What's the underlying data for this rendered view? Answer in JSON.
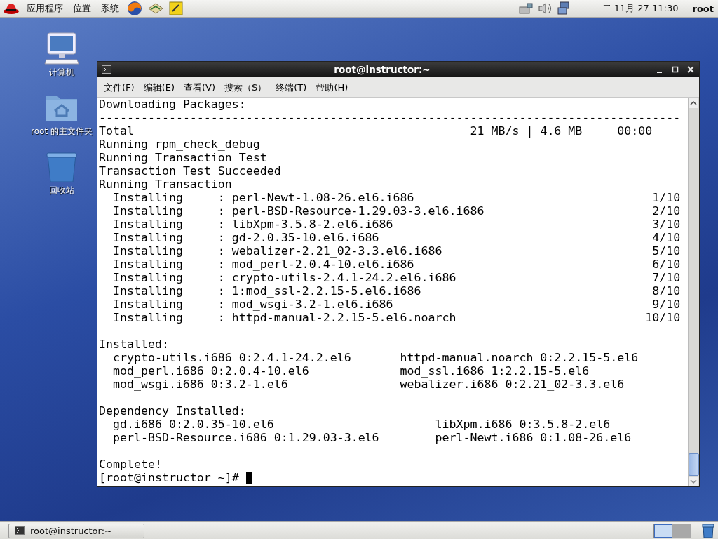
{
  "top_panel": {
    "menus": [
      "应用程序",
      "位置",
      "系统"
    ],
    "clock": "二 11月 27 11:30",
    "user": "root"
  },
  "desktop_icons": [
    {
      "kind": "computer",
      "label": "计算机"
    },
    {
      "kind": "home",
      "label": "root 的主文件夹"
    },
    {
      "kind": "trash",
      "label": "回收站"
    }
  ],
  "terminal": {
    "title": "root@instructor:~",
    "menus": [
      "文件(F)",
      "编辑(E)",
      "查看(V)",
      "搜索（S）",
      "终端(T)",
      "帮助(H)"
    ],
    "lines": [
      {
        "kind": "text",
        "text": "Downloading Packages:"
      },
      {
        "kind": "text",
        "text": "-----------------------------------------------------------------------------------"
      },
      {
        "kind": "total",
        "label": "Total",
        "speed": "21 MB/s | 4.6 MB",
        "time": "00:00"
      },
      {
        "kind": "text",
        "text": "Running rpm_check_debug"
      },
      {
        "kind": "text",
        "text": "Running Transaction Test"
      },
      {
        "kind": "text",
        "text": "Transaction Test Succeeded"
      },
      {
        "kind": "text",
        "text": "Running Transaction"
      },
      {
        "kind": "install",
        "action": "Installing",
        "separator": ":",
        "package": "perl-Newt-1.08-26.el6.i686",
        "progress": "1/10"
      },
      {
        "kind": "install",
        "action": "Installing",
        "separator": ":",
        "package": "perl-BSD-Resource-1.29.03-3.el6.i686",
        "progress": "2/10"
      },
      {
        "kind": "install",
        "action": "Installing",
        "separator": ":",
        "package": "libXpm-3.5.8-2.el6.i686",
        "progress": "3/10"
      },
      {
        "kind": "install",
        "action": "Installing",
        "separator": ":",
        "package": "gd-2.0.35-10.el6.i686",
        "progress": "4/10"
      },
      {
        "kind": "install",
        "action": "Installing",
        "separator": ":",
        "package": "webalizer-2.21_02-3.3.el6.i686",
        "progress": "5/10"
      },
      {
        "kind": "install",
        "action": "Installing",
        "separator": ":",
        "package": "mod_perl-2.0.4-10.el6.i686",
        "progress": "6/10"
      },
      {
        "kind": "install",
        "action": "Installing",
        "separator": ":",
        "package": "crypto-utils-2.4.1-24.2.el6.i686",
        "progress": "7/10"
      },
      {
        "kind": "install",
        "action": "Installing",
        "separator": ":",
        "package": "1:mod_ssl-2.2.15-5.el6.i686",
        "progress": "8/10"
      },
      {
        "kind": "install",
        "action": "Installing",
        "separator": ":",
        "package": "mod_wsgi-3.2-1.el6.i686",
        "progress": "9/10"
      },
      {
        "kind": "install",
        "action": "Installing",
        "separator": ":",
        "package": "httpd-manual-2.2.15-5.el6.noarch",
        "progress": "10/10"
      },
      {
        "kind": "blank"
      },
      {
        "kind": "text",
        "text": "Installed:"
      },
      {
        "kind": "installed-pair",
        "left": "crypto-utils.i686 0:2.4.1-24.2.el6",
        "right": "httpd-manual.noarch 0:2.2.15-5.el6"
      },
      {
        "kind": "installed-pair",
        "left": "mod_perl.i686 0:2.0.4-10.el6",
        "right": "mod_ssl.i686 1:2.2.15-5.el6"
      },
      {
        "kind": "installed-pair",
        "left": "mod_wsgi.i686 0:3.2-1.el6",
        "right": "webalizer.i686 0:2.21_02-3.3.el6"
      },
      {
        "kind": "blank"
      },
      {
        "kind": "text",
        "text": "Dependency Installed:"
      },
      {
        "kind": "dependency-pair",
        "left": "gd.i686 0:2.0.35-10.el6",
        "right": "libXpm.i686 0:3.5.8-2.el6"
      },
      {
        "kind": "dependency-pair",
        "left": "perl-BSD-Resource.i686 0:1.29.03-3.el6",
        "right": "perl-Newt.i686 0:1.08-26.el6"
      },
      {
        "kind": "blank"
      },
      {
        "kind": "text",
        "text": "Complete!"
      },
      {
        "kind": "prompt",
        "text": "[root@instructor ~]# "
      }
    ]
  },
  "taskbar": {
    "tasks": [
      {
        "label": "root@instructor:~",
        "selected": false
      }
    ],
    "workspaces": [
      {
        "selected": true
      },
      {
        "selected": false
      }
    ]
  }
}
